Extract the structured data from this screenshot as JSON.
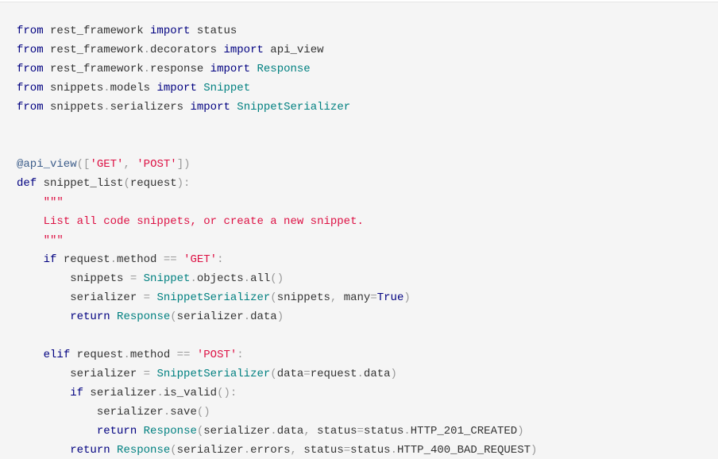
{
  "code": {
    "lines": [
      [
        [
          "kw",
          "from"
        ],
        [
          "t",
          " rest_framework "
        ],
        [
          "kw",
          "import"
        ],
        [
          "t",
          " status"
        ]
      ],
      [
        [
          "kw",
          "from"
        ],
        [
          "t",
          " rest_framework"
        ],
        [
          "p",
          "."
        ],
        [
          "t",
          "decorators "
        ],
        [
          "kw",
          "import"
        ],
        [
          "t",
          " api_view"
        ]
      ],
      [
        [
          "kw",
          "from"
        ],
        [
          "t",
          " rest_framework"
        ],
        [
          "p",
          "."
        ],
        [
          "t",
          "response "
        ],
        [
          "kw",
          "import"
        ],
        [
          "t",
          " "
        ],
        [
          "cls",
          "Response"
        ]
      ],
      [
        [
          "kw",
          "from"
        ],
        [
          "t",
          " snippets"
        ],
        [
          "p",
          "."
        ],
        [
          "t",
          "models "
        ],
        [
          "kw",
          "import"
        ],
        [
          "t",
          " "
        ],
        [
          "cls",
          "Snippet"
        ]
      ],
      [
        [
          "kw",
          "from"
        ],
        [
          "t",
          " snippets"
        ],
        [
          "p",
          "."
        ],
        [
          "t",
          "serializers "
        ],
        [
          "kw",
          "import"
        ],
        [
          "t",
          " "
        ],
        [
          "cls",
          "SnippetSerializer"
        ]
      ],
      [],
      [],
      [
        [
          "dec",
          "@api_view"
        ],
        [
          "p",
          "(["
        ],
        [
          "str",
          "'GET'"
        ],
        [
          "p",
          ","
        ],
        [
          "t",
          " "
        ],
        [
          "str",
          "'POST'"
        ],
        [
          "p",
          "])"
        ]
      ],
      [
        [
          "kw",
          "def"
        ],
        [
          "t",
          " snippet_list"
        ],
        [
          "p",
          "("
        ],
        [
          "t",
          "request"
        ],
        [
          "p",
          "):"
        ]
      ],
      [
        [
          "t",
          "    "
        ],
        [
          "str",
          "\"\"\""
        ]
      ],
      [
        [
          "t",
          "    "
        ],
        [
          "str",
          "List all code snippets, or create a new snippet."
        ]
      ],
      [
        [
          "t",
          "    "
        ],
        [
          "str",
          "\"\"\""
        ]
      ],
      [
        [
          "t",
          "    "
        ],
        [
          "kw",
          "if"
        ],
        [
          "t",
          " request"
        ],
        [
          "p",
          "."
        ],
        [
          "t",
          "method "
        ],
        [
          "p",
          "=="
        ],
        [
          "t",
          " "
        ],
        [
          "str",
          "'GET'"
        ],
        [
          "p",
          ":"
        ]
      ],
      [
        [
          "t",
          "        snippets "
        ],
        [
          "p",
          "="
        ],
        [
          "t",
          " "
        ],
        [
          "cls",
          "Snippet"
        ],
        [
          "p",
          "."
        ],
        [
          "t",
          "objects"
        ],
        [
          "p",
          "."
        ],
        [
          "t",
          "all"
        ],
        [
          "p",
          "()"
        ]
      ],
      [
        [
          "t",
          "        serializer "
        ],
        [
          "p",
          "="
        ],
        [
          "t",
          " "
        ],
        [
          "cls",
          "SnippetSerializer"
        ],
        [
          "p",
          "("
        ],
        [
          "t",
          "snippets"
        ],
        [
          "p",
          ","
        ],
        [
          "t",
          " many"
        ],
        [
          "p",
          "="
        ],
        [
          "kw",
          "True"
        ],
        [
          "p",
          ")"
        ]
      ],
      [
        [
          "t",
          "        "
        ],
        [
          "kw",
          "return"
        ],
        [
          "t",
          " "
        ],
        [
          "cls",
          "Response"
        ],
        [
          "p",
          "("
        ],
        [
          "t",
          "serializer"
        ],
        [
          "p",
          "."
        ],
        [
          "t",
          "data"
        ],
        [
          "p",
          ")"
        ]
      ],
      [],
      [
        [
          "t",
          "    "
        ],
        [
          "kw",
          "elif"
        ],
        [
          "t",
          " request"
        ],
        [
          "p",
          "."
        ],
        [
          "t",
          "method "
        ],
        [
          "p",
          "=="
        ],
        [
          "t",
          " "
        ],
        [
          "str",
          "'POST'"
        ],
        [
          "p",
          ":"
        ]
      ],
      [
        [
          "t",
          "        serializer "
        ],
        [
          "p",
          "="
        ],
        [
          "t",
          " "
        ],
        [
          "cls",
          "SnippetSerializer"
        ],
        [
          "p",
          "("
        ],
        [
          "t",
          "data"
        ],
        [
          "p",
          "="
        ],
        [
          "t",
          "request"
        ],
        [
          "p",
          "."
        ],
        [
          "t",
          "data"
        ],
        [
          "p",
          ")"
        ]
      ],
      [
        [
          "t",
          "        "
        ],
        [
          "kw",
          "if"
        ],
        [
          "t",
          " serializer"
        ],
        [
          "p",
          "."
        ],
        [
          "t",
          "is_valid"
        ],
        [
          "p",
          "():"
        ]
      ],
      [
        [
          "t",
          "            serializer"
        ],
        [
          "p",
          "."
        ],
        [
          "t",
          "save"
        ],
        [
          "p",
          "()"
        ]
      ],
      [
        [
          "t",
          "            "
        ],
        [
          "kw",
          "return"
        ],
        [
          "t",
          " "
        ],
        [
          "cls",
          "Response"
        ],
        [
          "p",
          "("
        ],
        [
          "t",
          "serializer"
        ],
        [
          "p",
          "."
        ],
        [
          "t",
          "data"
        ],
        [
          "p",
          ","
        ],
        [
          "t",
          " status"
        ],
        [
          "p",
          "="
        ],
        [
          "t",
          "status"
        ],
        [
          "p",
          "."
        ],
        [
          "t",
          "HTTP_201_CREATED"
        ],
        [
          "p",
          ")"
        ]
      ],
      [
        [
          "t",
          "        "
        ],
        [
          "kw",
          "return"
        ],
        [
          "t",
          " "
        ],
        [
          "cls",
          "Response"
        ],
        [
          "p",
          "("
        ],
        [
          "t",
          "serializer"
        ],
        [
          "p",
          "."
        ],
        [
          "t",
          "errors"
        ],
        [
          "p",
          ","
        ],
        [
          "t",
          " status"
        ],
        [
          "p",
          "="
        ],
        [
          "t",
          "status"
        ],
        [
          "p",
          "."
        ],
        [
          "t",
          "HTTP_400_BAD_REQUEST"
        ],
        [
          "p",
          ")"
        ]
      ]
    ]
  }
}
